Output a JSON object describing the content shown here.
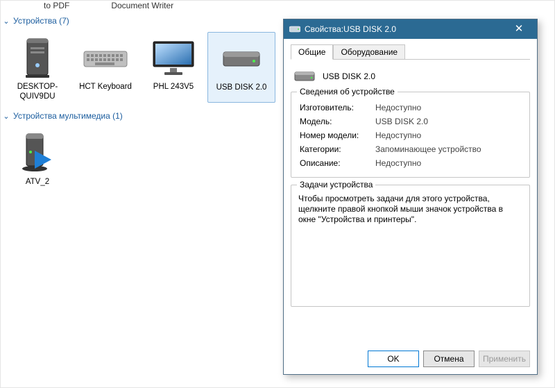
{
  "truncated_row": {
    "a": "to PDF",
    "b": "Document Writer"
  },
  "sections": {
    "devices_title": "Устройства (7)",
    "media_title": "Устройства мультимедиа (1)"
  },
  "devices": [
    {
      "label": "DESKTOP-QUIV9DU"
    },
    {
      "label": "HCT Keyboard"
    },
    {
      "label": "PHL 243V5"
    },
    {
      "label": "USB DISK 2.0"
    }
  ],
  "media": [
    {
      "label": "ATV_2"
    }
  ],
  "dialog": {
    "title_prefix": "Свойства: ",
    "title_device": "USB DISK 2.0",
    "tabs": {
      "general": "Общие",
      "hardware": "Оборудование"
    },
    "headline": "USB DISK 2.0",
    "group_info_title": "Сведения об устройстве",
    "info": {
      "manufacturer_k": "Изготовитель:",
      "manufacturer_v": "Недоступно",
      "model_k": "Модель:",
      "model_v": "USB DISK 2.0",
      "modelno_k": "Номер модели:",
      "modelno_v": "Недоступно",
      "category_k": "Категории:",
      "category_v": "Запоминающее устройство",
      "desc_k": "Описание:",
      "desc_v": "Недоступно"
    },
    "group_tasks_title": "Задачи устройства",
    "tasks_text": "Чтобы просмотреть задачи для этого устройства, щелкните правой кнопкой мыши значок устройства в окне \"Устройства и принтеры\".",
    "buttons": {
      "ok": "OK",
      "cancel": "Отмена",
      "apply": "Применить"
    }
  }
}
